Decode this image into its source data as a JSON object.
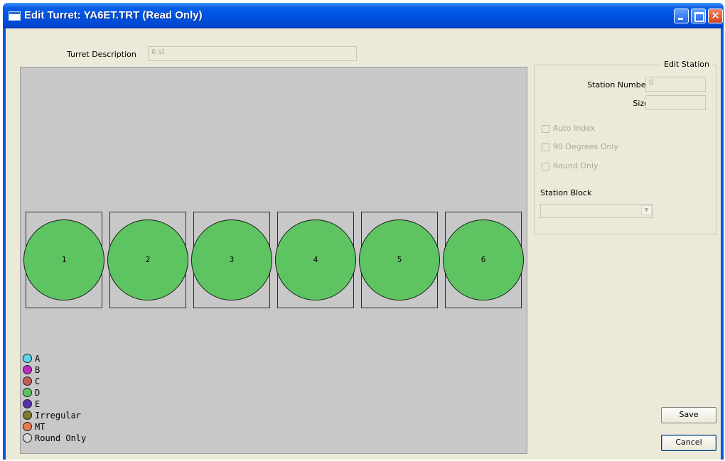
{
  "window": {
    "title": "Edit Turret: YA6ET.TRT (Read Only)"
  },
  "turret_description": {
    "label": "Turret Description",
    "value": "6 st"
  },
  "stations": [
    {
      "number": "1",
      "tool_type": "D"
    },
    {
      "number": "2",
      "tool_type": "D"
    },
    {
      "number": "3",
      "tool_type": "D"
    },
    {
      "number": "4",
      "tool_type": "D"
    },
    {
      "number": "5",
      "tool_type": "D"
    },
    {
      "number": "6",
      "tool_type": "D"
    }
  ],
  "legend": [
    {
      "label": "A",
      "color": "#5ad6ec"
    },
    {
      "label": "B",
      "color": "#c028c0"
    },
    {
      "label": "C",
      "color": "#c45b5b"
    },
    {
      "label": "D",
      "color": "#5ec462"
    },
    {
      "label": "E",
      "color": "#5a2fb0"
    },
    {
      "label": "Irregular",
      "color": "#7e7a2c"
    },
    {
      "label": "MT",
      "color": "#e97a4c"
    },
    {
      "label": "Round Only",
      "color": "#d8d8d8"
    }
  ],
  "edit_station": {
    "title": "Edit Station",
    "station_number_label": "Station Number",
    "station_number_value": "0",
    "size_label": "Size",
    "size_value": "",
    "auto_index_label": "Auto Index",
    "ninety_degrees_label": "90 Degrees Only",
    "round_only_label": "Round Only",
    "station_block_label": "Station Block",
    "station_block_value": ""
  },
  "buttons": {
    "save": "Save",
    "cancel": "Cancel"
  },
  "colors": {
    "canvas_background": "#c8c8c8",
    "station_fill": "#5ec462",
    "titlebar": "#0054e3"
  }
}
